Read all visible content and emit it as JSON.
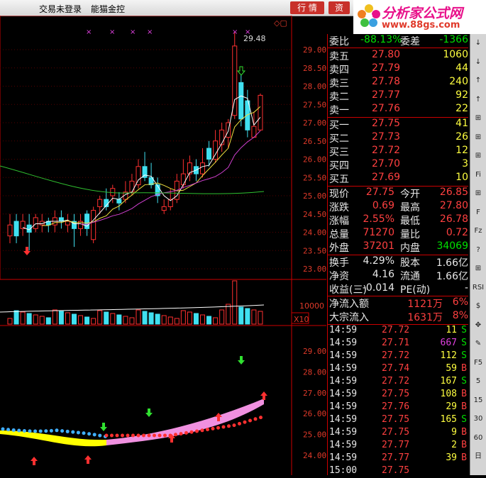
{
  "topbar": {
    "login": "交易未登录",
    "stock_name": "能猫金控",
    "btn1": "行 情",
    "btn2": "资"
  },
  "logo": {
    "brand": "分析家公式网",
    "url": "www.88gs.com"
  },
  "main_chart": {
    "price_axis": [
      "29.00",
      "28.50",
      "28.00",
      "27.50",
      "27.00",
      "26.50",
      "26.00",
      "25.50",
      "25.00",
      "24.50",
      "24.00",
      "23.50",
      "23.00"
    ],
    "high_label": "29.48",
    "candles": [
      {
        "o": 23.9,
        "c": 24.2,
        "h": 24.5,
        "l": 23.7
      },
      {
        "o": 24.3,
        "c": 23.9,
        "h": 24.5,
        "l": 23.7
      },
      {
        "o": 24.1,
        "c": 24.3,
        "h": 24.5,
        "l": 23.9
      },
      {
        "o": 24.2,
        "c": 24.0,
        "h": 24.5,
        "l": 23.5
      },
      {
        "o": 24.1,
        "c": 24.4,
        "h": 24.5,
        "l": 24.0
      },
      {
        "o": 24.2,
        "c": 24.3,
        "h": 24.5,
        "l": 24.0
      },
      {
        "o": 24.3,
        "c": 24.2,
        "h": 24.4,
        "l": 24.0
      },
      {
        "o": 24.2,
        "c": 24.4,
        "h": 24.6,
        "l": 24.0
      },
      {
        "o": 24.4,
        "c": 24.3,
        "h": 24.6,
        "l": 24.1
      },
      {
        "o": 24.2,
        "c": 24.3,
        "h": 24.5,
        "l": 24.0
      },
      {
        "o": 24.3,
        "c": 24.1,
        "h": 24.5,
        "l": 23.6
      },
      {
        "o": 24.1,
        "c": 24.3,
        "h": 24.5,
        "l": 23.9
      },
      {
        "o": 24.5,
        "c": 24.1,
        "h": 24.6,
        "l": 23.9
      },
      {
        "o": 23.8,
        "c": 24.6,
        "h": 24.7,
        "l": 23.7
      },
      {
        "o": 24.7,
        "c": 24.9,
        "h": 25.0,
        "l": 24.5
      },
      {
        "o": 24.9,
        "c": 24.7,
        "h": 25.2,
        "l": 24.6
      },
      {
        "o": 25.0,
        "c": 25.2,
        "h": 25.3,
        "l": 24.8
      },
      {
        "o": 24.9,
        "c": 24.8,
        "h": 25.1,
        "l": 24.6
      },
      {
        "o": 24.9,
        "c": 25.1,
        "h": 25.4,
        "l": 24.8
      },
      {
        "o": 25.1,
        "c": 25.4,
        "h": 25.6,
        "l": 25.0
      },
      {
        "o": 25.3,
        "c": 25.8,
        "h": 26.0,
        "l": 25.2
      },
      {
        "o": 25.8,
        "c": 25.5,
        "h": 26.2,
        "l": 25.4
      },
      {
        "o": 25.5,
        "c": 25.3,
        "h": 25.9,
        "l": 25.2
      },
      {
        "o": 25.3,
        "c": 25.0,
        "h": 25.5,
        "l": 24.8
      },
      {
        "o": 24.6,
        "c": 24.7,
        "h": 24.9,
        "l": 24.5
      },
      {
        "o": 24.7,
        "c": 24.9,
        "h": 25.2,
        "l": 24.6
      },
      {
        "o": 24.9,
        "c": 25.4,
        "h": 25.6,
        "l": 24.8
      },
      {
        "o": 25.3,
        "c": 25.6,
        "h": 26.0,
        "l": 25.2
      },
      {
        "o": 25.6,
        "c": 25.9,
        "h": 26.1,
        "l": 25.4
      },
      {
        "o": 25.8,
        "c": 25.6,
        "h": 26.0,
        "l": 25.4
      },
      {
        "o": 25.6,
        "c": 25.9,
        "h": 26.3,
        "l": 25.5
      },
      {
        "o": 26.3,
        "c": 26.0,
        "h": 26.5,
        "l": 25.8
      },
      {
        "o": 26.0,
        "c": 26.5,
        "h": 26.8,
        "l": 25.9
      },
      {
        "o": 26.4,
        "c": 26.8,
        "h": 27.0,
        "l": 26.2
      },
      {
        "o": 26.6,
        "c": 27.0,
        "h": 27.1,
        "l": 26.3
      },
      {
        "o": 27.2,
        "c": 29.1,
        "h": 29.48,
        "l": 27.1
      },
      {
        "o": 28.1,
        "c": 27.1,
        "h": 28.3,
        "l": 26.9
      },
      {
        "o": 27.6,
        "c": 26.8,
        "h": 27.9,
        "l": 26.6
      },
      {
        "o": 26.6,
        "c": 26.9,
        "h": 27.3,
        "l": 26.6
      },
      {
        "o": 26.8,
        "c": 27.75,
        "h": 27.8,
        "l": 26.78
      }
    ]
  },
  "quote": {
    "weibi": {
      "label": "委比",
      "value": "-88.13%",
      "label2": "委差",
      "value2": "-1366"
    },
    "sell": [
      {
        "label": "卖五",
        "price": "27.80",
        "vol": "1060"
      },
      {
        "label": "卖四",
        "price": "27.79",
        "vol": "44"
      },
      {
        "label": "卖三",
        "price": "27.78",
        "vol": "240"
      },
      {
        "label": "卖二",
        "price": "27.77",
        "vol": "92"
      },
      {
        "label": "卖一",
        "price": "27.76",
        "vol": "22"
      }
    ],
    "buy": [
      {
        "label": "买一",
        "price": "27.75",
        "vol": "41"
      },
      {
        "label": "买二",
        "price": "27.73",
        "vol": "26"
      },
      {
        "label": "买三",
        "price": "27.72",
        "vol": "12"
      },
      {
        "label": "买四",
        "price": "27.70",
        "vol": "3"
      },
      {
        "label": "买五",
        "price": "27.69",
        "vol": "10"
      }
    ],
    "stats": [
      {
        "l1": "现价",
        "v1": "27.75",
        "l2": "今开",
        "v2": "26.85"
      },
      {
        "l1": "涨跌",
        "v1": "0.69",
        "l2": "最高",
        "v2": "27.80"
      },
      {
        "l1": "涨幅",
        "v1": "2.55%",
        "l2": "最低",
        "v2": "26.78"
      },
      {
        "l1": "总量",
        "v1": "71270",
        "l2": "量比",
        "v2": "0.72"
      },
      {
        "l1": "外盘",
        "v1": "37201",
        "l2": "内盘",
        "v2": "34069"
      }
    ],
    "stats2": [
      {
        "l1": "换手",
        "v1": "4.29%",
        "l2": "股本",
        "v2": "1.66亿"
      },
      {
        "l1": "净资",
        "v1": "4.16",
        "l2": "流通",
        "v2": "1.66亿"
      },
      {
        "l1": "收益(三)",
        "v1": "-0.014",
        "l2": "PE(动)",
        "v2": "-"
      }
    ],
    "flow": [
      {
        "label": "净流入额",
        "value": "1121万",
        "pct": "6%"
      },
      {
        "label": "大宗流入",
        "value": "1631万",
        "pct": "8%"
      }
    ]
  },
  "ticks": [
    {
      "t": "14:59",
      "p": "27.72",
      "v": "11",
      "s": "S"
    },
    {
      "t": "14:59",
      "p": "27.71",
      "v": "667",
      "s": "S"
    },
    {
      "t": "14:59",
      "p": "27.72",
      "v": "112",
      "s": "S"
    },
    {
      "t": "14:59",
      "p": "27.74",
      "v": "59",
      "s": "B"
    },
    {
      "t": "14:59",
      "p": "27.72",
      "v": "167",
      "s": "S"
    },
    {
      "t": "14:59",
      "p": "27.75",
      "v": "108",
      "s": "B"
    },
    {
      "t": "14:59",
      "p": "27.76",
      "v": "29",
      "s": "B"
    },
    {
      "t": "14:59",
      "p": "27.75",
      "v": "165",
      "s": "S"
    },
    {
      "t": "14:59",
      "p": "27.75",
      "v": "9",
      "s": "B"
    },
    {
      "t": "14:59",
      "p": "27.77",
      "v": "2",
      "s": "B"
    },
    {
      "t": "14:59",
      "p": "27.77",
      "v": "39",
      "s": "B"
    },
    {
      "t": "15:00",
      "p": "27.75",
      "v": "",
      "s": ""
    }
  ],
  "volume": {
    "label": "10000",
    "x10": "X10"
  },
  "lower": {
    "axis": [
      "29.00",
      "28.00",
      "27.00",
      "26.00",
      "25.00",
      "24.00"
    ]
  },
  "tools": [
    "↓",
    "↓",
    "↑",
    "↑",
    "⊞",
    "⊞",
    "⊞",
    "Fi",
    "⊞",
    "F",
    "Fz",
    "?",
    "⊞",
    "RSI",
    "$",
    "✥",
    "✎",
    "F5",
    "5",
    "15",
    "30",
    "60",
    "日"
  ]
}
